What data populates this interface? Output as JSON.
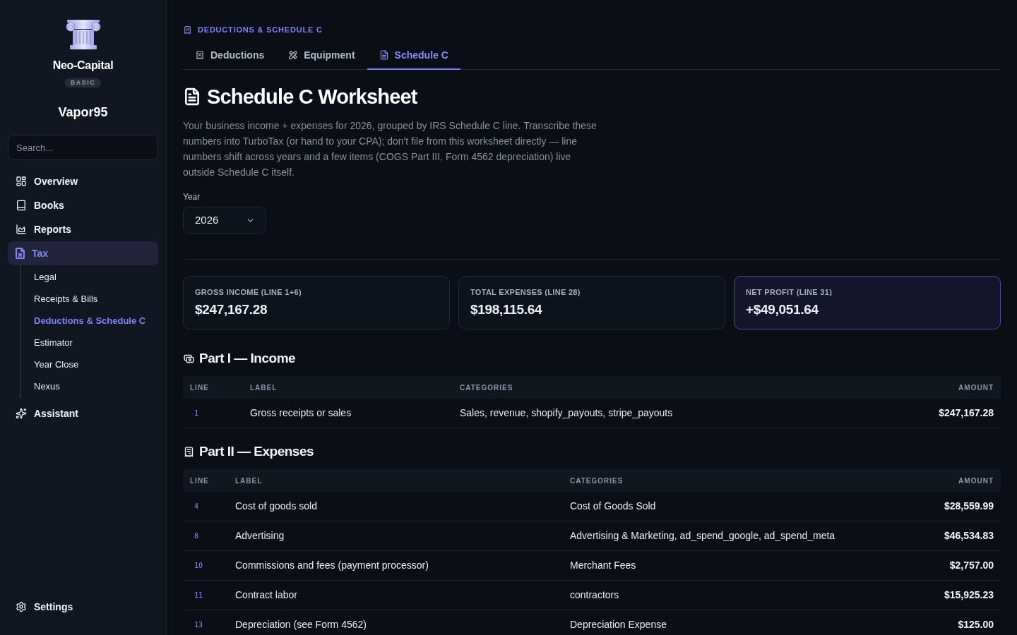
{
  "sidebar": {
    "brand": {
      "name": "Neo-Capital",
      "plan": "BASIC"
    },
    "workspace": "Vapor95",
    "search": {
      "placeholder": "Search..."
    },
    "nav": [
      {
        "label": "Overview",
        "selected": false
      },
      {
        "label": "Books",
        "selected": false
      },
      {
        "label": "Reports",
        "selected": false
      },
      {
        "label": "Tax",
        "selected": true,
        "children": [
          {
            "label": "Legal",
            "selected": false
          },
          {
            "label": "Receipts & Bills",
            "selected": false
          },
          {
            "label": "Deductions & Schedule C",
            "selected": true
          },
          {
            "label": "Estimator",
            "selected": false
          },
          {
            "label": "Year Close",
            "selected": false
          },
          {
            "label": "Nexus",
            "selected": false
          }
        ]
      },
      {
        "label": "Assistant",
        "selected": false
      }
    ],
    "footer": {
      "label": "Settings"
    }
  },
  "header": {
    "breadcrumb": "DEDUCTIONS & SCHEDULE C",
    "tabs": [
      {
        "label": "Deductions",
        "selected": false
      },
      {
        "label": "Equipment",
        "selected": false
      },
      {
        "label": "Schedule C",
        "selected": true
      }
    ]
  },
  "page": {
    "title": "Schedule C Worksheet",
    "description": "Your business income + expenses for 2026, grouped by IRS Schedule C line. Transcribe these numbers into TurboTax (or hand to your CPA); don't file from this worksheet directly — line numbers shift across years and a few items (COGS Part III, Form 4562 depreciation) live outside Schedule C itself.",
    "year": {
      "label": "Year",
      "value": "2026"
    }
  },
  "summary_cards": [
    {
      "label": "GROSS INCOME (LINE 1+6)",
      "value": "$247,167.28",
      "accent": false
    },
    {
      "label": "TOTAL EXPENSES (LINE 28)",
      "value": "$198,115.64",
      "accent": false
    },
    {
      "label": "NET PROFIT (LINE 31)",
      "value": "+$49,051.64",
      "accent": true
    }
  ],
  "income": {
    "title": "Part I — Income",
    "columns": [
      "LINE",
      "LABEL",
      "CATEGORIES",
      "AMOUNT"
    ],
    "rows": [
      {
        "line": "1",
        "label": "Gross receipts or sales",
        "categories": "Sales, revenue, shopify_payouts, stripe_payouts",
        "amount": "$247,167.28"
      }
    ]
  },
  "expenses": {
    "title": "Part II — Expenses",
    "columns": [
      "LINE",
      "LABEL",
      "CATEGORIES",
      "AMOUNT"
    ],
    "rows": [
      {
        "line": "4",
        "label": "Cost of goods sold",
        "categories": "Cost of Goods Sold",
        "amount": "$28,559.99"
      },
      {
        "line": "8",
        "label": "Advertising",
        "categories": "Advertising & Marketing, ad_spend_google, ad_spend_meta",
        "amount": "$46,534.83"
      },
      {
        "line": "10",
        "label": "Commissions and fees (payment processor)",
        "categories": "Merchant Fees",
        "amount": "$2,757.00"
      },
      {
        "line": "11",
        "label": "Contract labor",
        "categories": "contractors",
        "amount": "$15,925.23"
      },
      {
        "line": "13",
        "label": "Depreciation (see Form 4562)",
        "categories": "Depreciation Expense",
        "amount": "$125.00"
      }
    ]
  }
}
